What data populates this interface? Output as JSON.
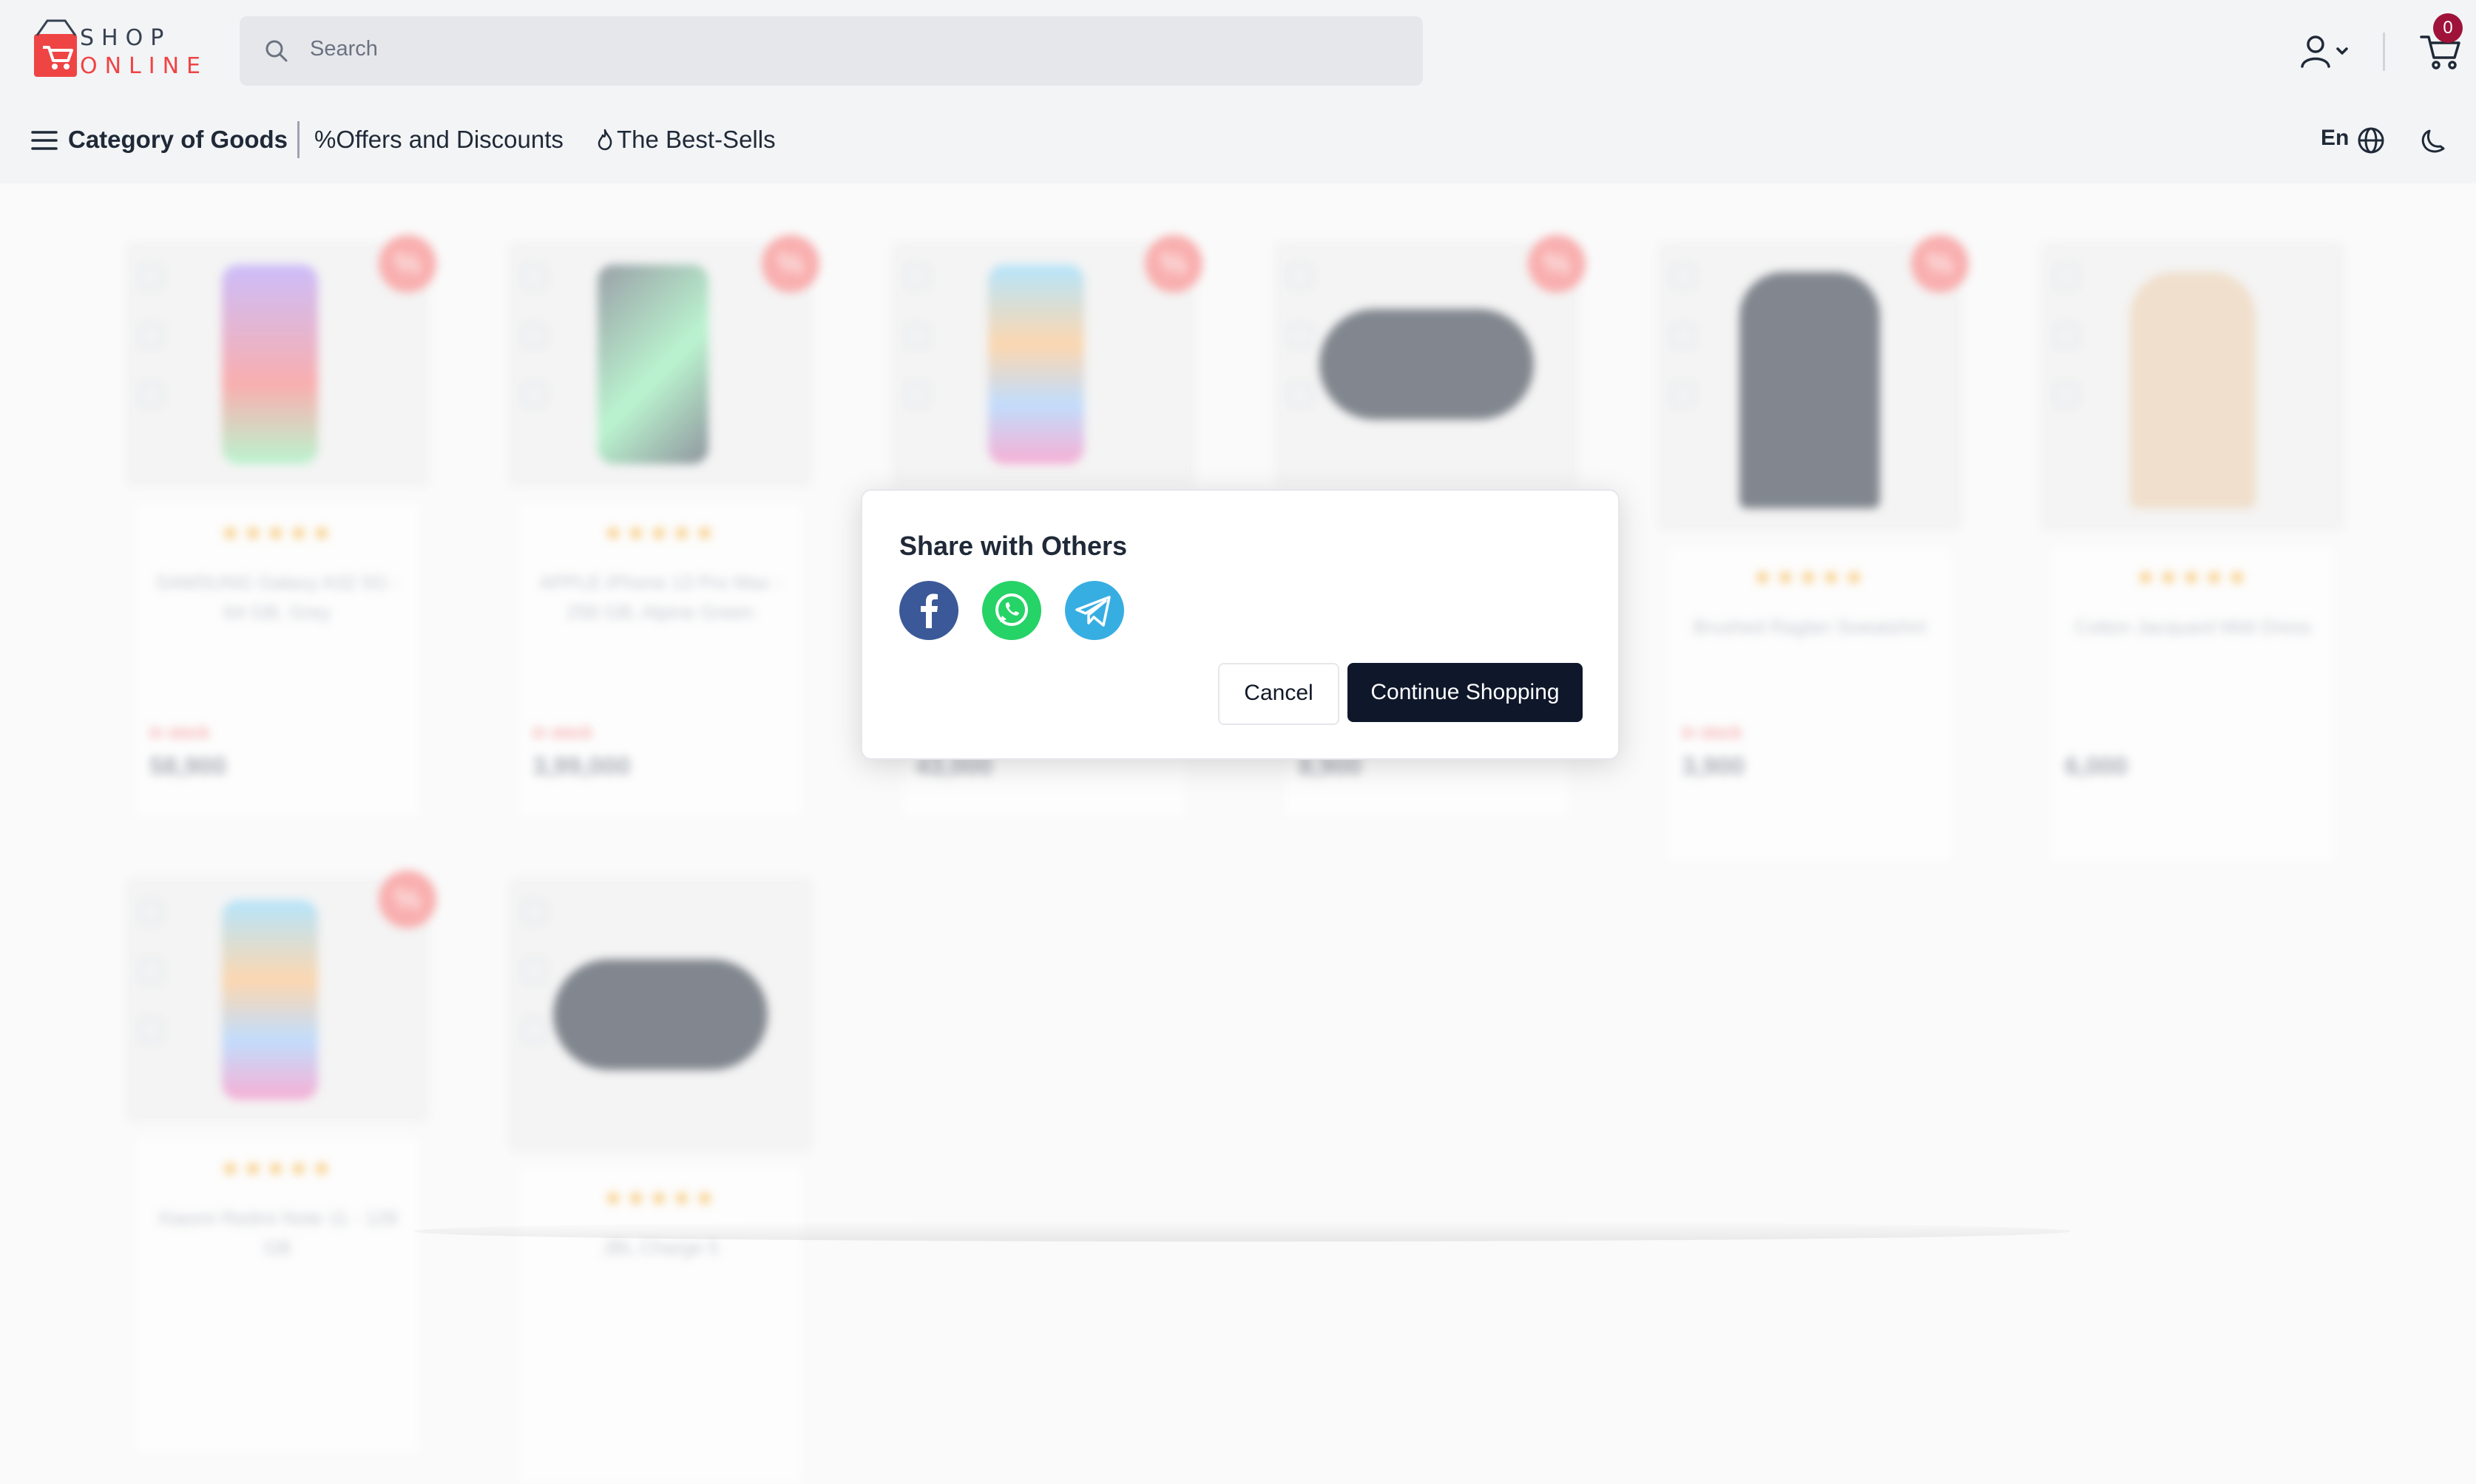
{
  "header": {
    "logo": {
      "line1": "SHOP",
      "line2": "ONLINE"
    },
    "search": {
      "placeholder": "Search"
    },
    "cart_count": "0"
  },
  "nav": {
    "category_label": "Category of Goods",
    "offers_label": "Offers and Discounts",
    "bestsells_label": "The Best-Sells",
    "language": "En"
  },
  "products": [
    {
      "name": "SAMSUNG Galaxy A32 5G - 64 GB, Grey",
      "stars": "★★★★★",
      "stock": "in stock",
      "price": "58,900",
      "discount": "%"
    },
    {
      "name": "APPLE iPhone 13 Pro Max - 256 GB, Alpine Green",
      "stars": "★★★★★",
      "stock": "in stock",
      "price": "3,99,000",
      "discount": "%"
    },
    {
      "name": "",
      "stars": "",
      "stock": "",
      "price": "43,000",
      "discount": "%"
    },
    {
      "name": "",
      "stars": "",
      "stock": "",
      "price": "8,900",
      "discount": "%"
    },
    {
      "name": "Brushed Raglan Sweatshirt",
      "stars": "★★★★★",
      "stock": "in stock",
      "price": "3,900",
      "discount": "%"
    },
    {
      "name": "Cotton Jacquard Midi Dress",
      "stars": "★★★★★",
      "stock": "",
      "price": "6,000",
      "discount": ""
    },
    {
      "name": "Xiaomi Redmi Note 11 - 128 GB",
      "stars": "★★★★★",
      "stock": "",
      "price": "",
      "discount": "%"
    },
    {
      "name": "JBL Charge 5",
      "stars": "★★★★★",
      "stock": "",
      "price": "",
      "discount": ""
    }
  ],
  "modal": {
    "title": "Share with Others",
    "share_targets": [
      "facebook-icon",
      "whatsapp-icon",
      "telegram-icon"
    ],
    "cancel_label": "Cancel",
    "continue_label": "Continue Shopping"
  },
  "colors": {
    "accent": "#0f172a",
    "brand": "#ef4444",
    "badge": "#9f1239",
    "facebook": "#3b5998",
    "whatsapp": "#25d366",
    "telegram": "#37aee2"
  }
}
